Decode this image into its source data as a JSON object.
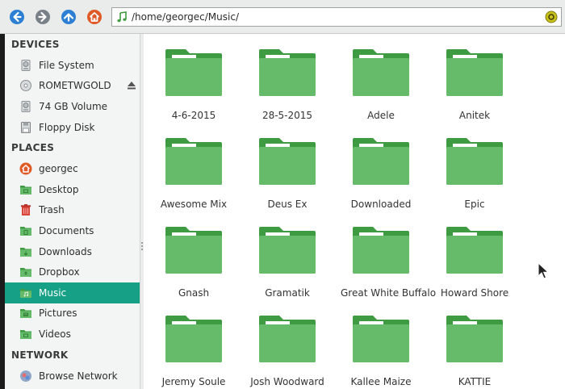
{
  "toolbar": {
    "path": "/home/georgec/Music/",
    "buttons": [
      "back-icon",
      "forward-icon",
      "up-icon",
      "home-icon"
    ]
  },
  "sidebar": {
    "sections": [
      {
        "title": "DEVICES",
        "items": [
          {
            "label": "File System",
            "icon": "harddisk-icon"
          },
          {
            "label": "ROMETWGOLD",
            "icon": "optical-disc-icon",
            "eject": true
          },
          {
            "label": "74 GB Volume",
            "icon": "drive-icon"
          },
          {
            "label": "Floppy Disk",
            "icon": "floppy-icon"
          }
        ]
      },
      {
        "title": "PLACES",
        "items": [
          {
            "label": "georgec",
            "icon": "home-icon"
          },
          {
            "label": "Desktop",
            "icon": "desktop-folder-icon"
          },
          {
            "label": "Trash",
            "icon": "trash-icon"
          },
          {
            "label": "Documents",
            "icon": "documents-folder-icon"
          },
          {
            "label": "Downloads",
            "icon": "downloads-folder-icon"
          },
          {
            "label": "Dropbox",
            "icon": "dropbox-folder-icon"
          },
          {
            "label": "Music",
            "icon": "music-folder-icon",
            "active": true
          },
          {
            "label": "Pictures",
            "icon": "pictures-folder-icon"
          },
          {
            "label": "Videos",
            "icon": "videos-folder-icon"
          }
        ]
      },
      {
        "title": "NETWORK",
        "items": [
          {
            "label": "Browse Network",
            "icon": "network-icon"
          }
        ]
      }
    ]
  },
  "folders": [
    "4-6-2015",
    "28-5-2015",
    "Adele",
    "Anitek",
    "Awesome Mix",
    "Deus Ex",
    "Downloaded",
    "Epic",
    "Gnash",
    "Gramatik",
    "Great White Buffalo",
    "Howard Shore",
    "Jeremy Soule",
    "Josh Woodward",
    "Kallee Maize",
    "KATTIE"
  ],
  "colors": {
    "accent": "#16a085",
    "folder_body": "#66bb6a",
    "folder_tab": "#43a047"
  }
}
